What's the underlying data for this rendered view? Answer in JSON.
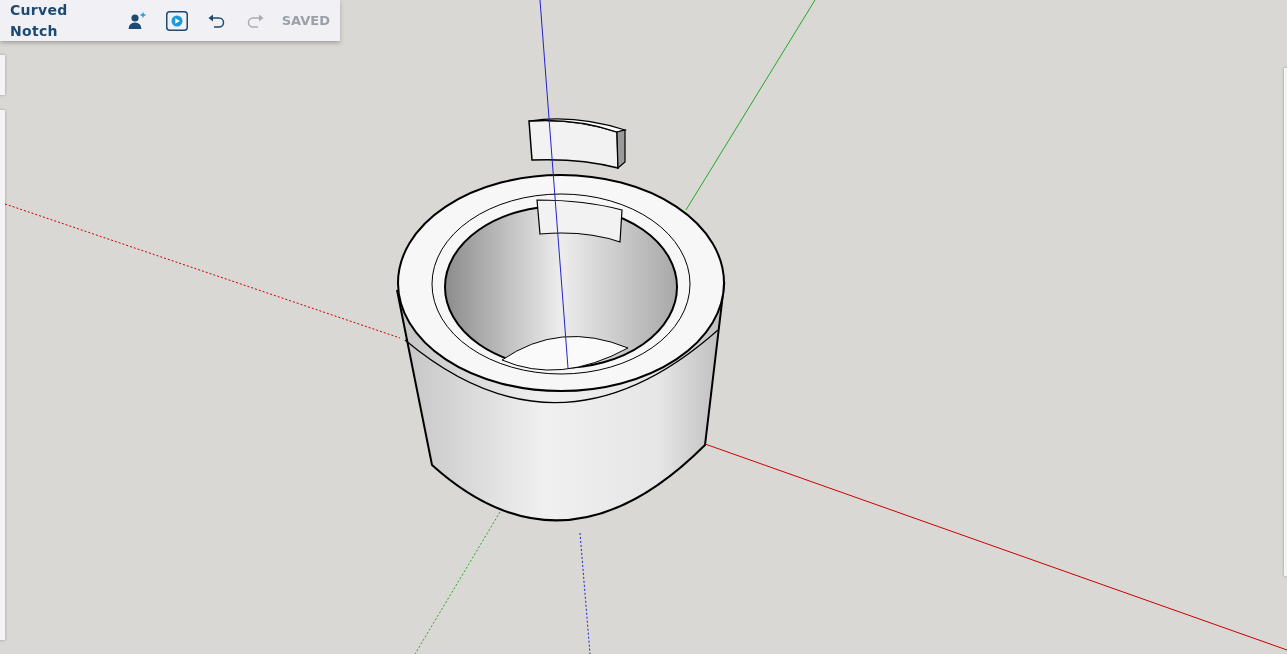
{
  "document_title": "Curved Notch",
  "toolbar": [
    {
      "kind": "share",
      "disabled": false
    },
    {
      "kind": "present",
      "disabled": false
    },
    {
      "kind": "undo",
      "disabled": false
    },
    {
      "kind": "redo",
      "disabled": true
    }
  ],
  "save_status": "SAVED"
}
